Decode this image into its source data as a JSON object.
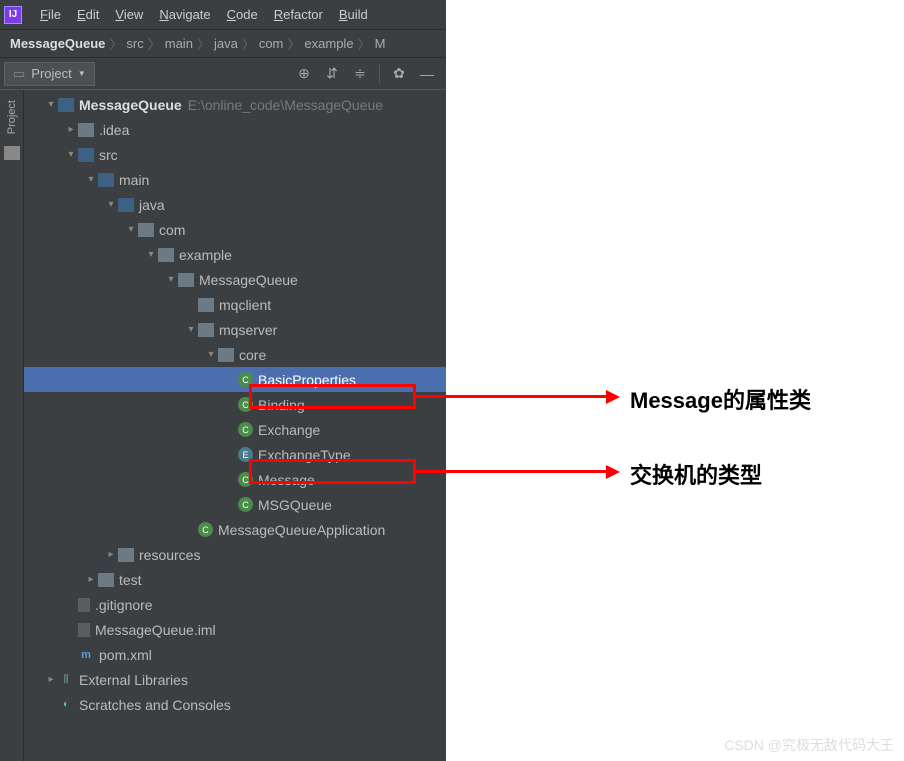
{
  "menubar": {
    "items": [
      {
        "u": "F",
        "rest": "ile"
      },
      {
        "u": "E",
        "rest": "dit"
      },
      {
        "u": "V",
        "rest": "iew"
      },
      {
        "u": "N",
        "rest": "avigate"
      },
      {
        "u": "C",
        "rest": "ode"
      },
      {
        "u": "R",
        "rest": "efactor"
      },
      {
        "u": "B",
        "rest": "uild"
      }
    ]
  },
  "breadcrumb": [
    {
      "label": "MessageQueue",
      "bold": true
    },
    {
      "label": "src"
    },
    {
      "label": "main"
    },
    {
      "label": "java"
    },
    {
      "label": "com"
    },
    {
      "label": "example"
    },
    {
      "label": "M"
    }
  ],
  "toolbar": {
    "project_label": "Project"
  },
  "sidebar": {
    "label": "Project"
  },
  "tree": [
    {
      "indent": 20,
      "arrow": "down",
      "icon": "module-icon",
      "label": "MessageQueue",
      "bold": true,
      "suffix": "E:\\online_code\\MessageQueue"
    },
    {
      "indent": 40,
      "arrow": "right",
      "icon": "folder",
      "label": ".idea"
    },
    {
      "indent": 40,
      "arrow": "down",
      "icon": "folder-blue",
      "label": "src"
    },
    {
      "indent": 60,
      "arrow": "down",
      "icon": "folder-blue",
      "label": "main"
    },
    {
      "indent": 80,
      "arrow": "down",
      "icon": "folder-blue",
      "label": "java"
    },
    {
      "indent": 100,
      "arrow": "down",
      "icon": "folder",
      "label": "com"
    },
    {
      "indent": 120,
      "arrow": "down",
      "icon": "folder",
      "label": "example"
    },
    {
      "indent": 140,
      "arrow": "down",
      "icon": "folder",
      "label": "MessageQueue"
    },
    {
      "indent": 160,
      "arrow": "",
      "icon": "folder",
      "label": "mqclient"
    },
    {
      "indent": 160,
      "arrow": "down",
      "icon": "folder",
      "label": "mqserver"
    },
    {
      "indent": 180,
      "arrow": "down",
      "icon": "folder",
      "label": "core"
    },
    {
      "indent": 200,
      "arrow": "",
      "icon": "class-icon",
      "iconText": "C",
      "label": "BasicProperties",
      "selected": true
    },
    {
      "indent": 200,
      "arrow": "",
      "icon": "class-icon",
      "iconText": "C",
      "label": "Binding"
    },
    {
      "indent": 200,
      "arrow": "",
      "icon": "class-icon",
      "iconText": "C",
      "label": "Exchange"
    },
    {
      "indent": 200,
      "arrow": "",
      "icon": "enum-icon",
      "iconText": "E",
      "label": "ExchangeType"
    },
    {
      "indent": 200,
      "arrow": "",
      "icon": "class-icon",
      "iconText": "C",
      "label": "Message"
    },
    {
      "indent": 200,
      "arrow": "",
      "icon": "class-icon",
      "iconText": "C",
      "label": "MSGQueue"
    },
    {
      "indent": 160,
      "arrow": "",
      "icon": "class-icon",
      "iconText": "C",
      "label": "MessageQueueApplication"
    },
    {
      "indent": 80,
      "arrow": "right",
      "icon": "folder",
      "label": "resources"
    },
    {
      "indent": 60,
      "arrow": "right",
      "icon": "folder",
      "label": "test"
    },
    {
      "indent": 40,
      "arrow": "",
      "icon": "file-icon",
      "label": ".gitignore"
    },
    {
      "indent": 40,
      "arrow": "",
      "icon": "file-icon",
      "label": "MessageQueue.iml"
    },
    {
      "indent": 40,
      "arrow": "",
      "icon": "xml-icon",
      "iconText": "m",
      "label": "pom.xml"
    },
    {
      "indent": 20,
      "arrow": "right",
      "icon": "lib-icon",
      "iconText": "⫼",
      "label": "External Libraries"
    },
    {
      "indent": 20,
      "arrow": "",
      "icon": "scratch-icon",
      "iconText": "◐",
      "label": "Scratches and Consoles"
    }
  ],
  "annotations": {
    "a1": "Message的属性类",
    "a2": "交换机的类型"
  },
  "watermark": "CSDN @究极无敌代码大王"
}
